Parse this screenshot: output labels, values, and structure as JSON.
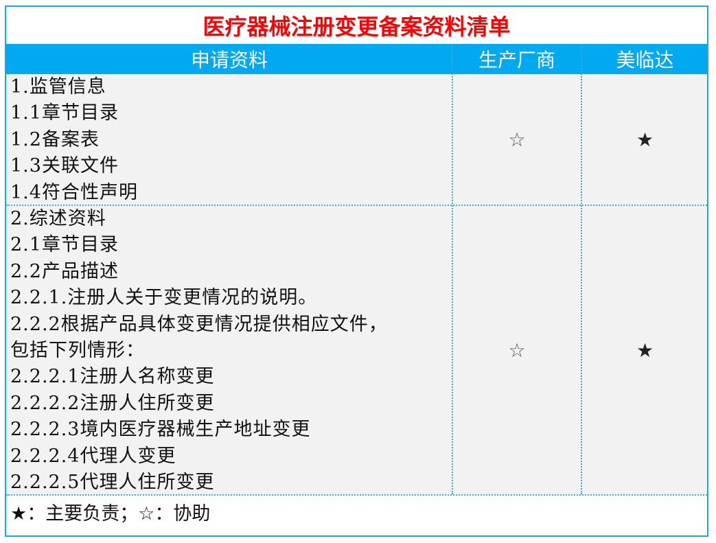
{
  "title": "医疗器械注册变更备案资料清单",
  "header": {
    "col1": "申请资料",
    "col2": "生产厂商",
    "col3": "美临达"
  },
  "rows": [
    {
      "lines": [
        "1.监管信息",
        "1.1章节目录",
        "1.2备案表",
        "1.3关联文件",
        "1.4符合性声明"
      ],
      "manufacturer": "☆",
      "meilinda": "★"
    },
    {
      "lines": [
        "2.综述资料",
        "2.1章节目录",
        "2.2产品描述",
        "2.2.1.注册人关于变更情况的说明。",
        "2.2.2根据产品具体变更情况提供相应文件，",
        "包括下列情形：",
        "2.2.2.1注册人名称变更",
        "2.2.2.2注册人住所变更",
        "2.2.2.3境内医疗器械生产地址变更",
        "2.2.2.4代理人变更",
        "2.2.2.5代理人住所变更"
      ],
      "manufacturer": "☆",
      "meilinda": "★"
    }
  ],
  "legend": "★：主要负责；☆：协助",
  "colors": {
    "title": "#ff0000",
    "header_bg": "#00a9f0",
    "border": "#1aa7e8",
    "row_bg": "#f2f2f2"
  }
}
